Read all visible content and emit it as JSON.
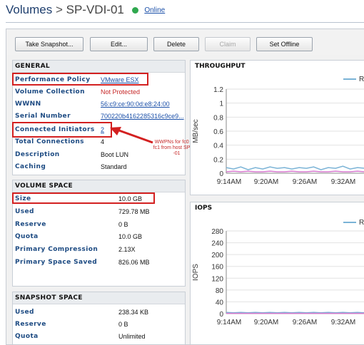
{
  "header": {
    "title": "Volumes",
    "separator": ">",
    "volume_name": "SP-VDI-01",
    "status": "Online",
    "status_color": "#2fa84f"
  },
  "toolbar": {
    "take_snapshot": "Take Snapshot...",
    "edit": "Edit...",
    "delete": "Delete",
    "claim": "Claim",
    "set_offline": "Set Offline"
  },
  "general": {
    "title": "GENERAL",
    "rows": [
      {
        "label": "Performance Policy",
        "value": "VMware ESX"
      },
      {
        "label": "Volume Collection",
        "value": "Not Protected"
      },
      {
        "label": "WWNN",
        "value": "56:c9:ce:90:0d:e8:24:00"
      },
      {
        "label": "Serial Number",
        "value": "700220b4162285316c9ce9..."
      },
      {
        "label": "Connected Initiators",
        "value": "2"
      },
      {
        "label": "Total Connections",
        "value": "4"
      },
      {
        "label": "Description",
        "value": "Boot LUN"
      },
      {
        "label": "Caching",
        "value": "Standard"
      }
    ]
  },
  "annotation": {
    "lines": [
      "WWPNs for fc0 and",
      "fc1 from host SP-VDI",
      "-01"
    ]
  },
  "volume_space": {
    "title": "VOLUME SPACE",
    "rows": [
      {
        "label": "Size",
        "value": "10.0 GB"
      },
      {
        "label": "Used",
        "value": "729.78 MB"
      },
      {
        "label": "Reserve",
        "value": "0 B"
      },
      {
        "label": "Quota",
        "value": "10.0 GB"
      },
      {
        "label": "Primary Compression",
        "value": "2.13X"
      },
      {
        "label": "Primary Space Saved",
        "value": "826.06 MB"
      }
    ]
  },
  "snapshot_space": {
    "title": "SNAPSHOT SPACE",
    "rows": [
      {
        "label": "Used",
        "value": "238.34 KB"
      },
      {
        "label": "Reserve",
        "value": "0 B"
      },
      {
        "label": "Quota",
        "value": "Unlimited"
      }
    ]
  },
  "colors": {
    "accent_red": "#d32020",
    "series_blue": "#7ab3d6",
    "series_pink": "#d87bd0"
  },
  "chart_data": [
    {
      "type": "line",
      "title": "THROUGHPUT",
      "ylabel": "MB/sec",
      "xlabel": "",
      "yticks": [
        "1.2",
        "1",
        "0.8",
        "0.6",
        "0.4",
        "0.2",
        "0"
      ],
      "ylim": [
        0,
        1.2
      ],
      "xticks": [
        "9:14AM",
        "9:20AM",
        "9:26AM",
        "9:32AM"
      ],
      "legend_placement": "top-right",
      "legend_label": "R",
      "grid": true,
      "series": [
        {
          "color": "#7ab3d6",
          "values": [
            0.08,
            0.06,
            0.09,
            0.05,
            0.08,
            0.06,
            0.09,
            0.07,
            0.08,
            0.06,
            0.08,
            0.07,
            0.09,
            0.05,
            0.08,
            0.07,
            0.1,
            0.06,
            0.08,
            0.07
          ]
        },
        {
          "color": "#d87bd0",
          "values": [
            0.02,
            0.03,
            0.02,
            0.03,
            0.02,
            0.02,
            0.03,
            0.02,
            0.02,
            0.03,
            0.02,
            0.02,
            0.03,
            0.02,
            0.02,
            0.03,
            0.02,
            0.02,
            0.03,
            0.02
          ]
        }
      ]
    },
    {
      "type": "line",
      "title": "IOPS",
      "ylabel": "IOPS",
      "xlabel": "",
      "yticks": [
        "280",
        "240",
        "200",
        "160",
        "120",
        "80",
        "40",
        "0"
      ],
      "ylim": [
        0,
        280
      ],
      "xticks": [
        "9:14AM",
        "9:20AM",
        "9:26AM",
        "9:32AM"
      ],
      "legend_placement": "top-right",
      "legend_label": "R",
      "grid": true,
      "series": [
        {
          "color": "#7ab3d6",
          "values": [
            4,
            3,
            4,
            3,
            4,
            3,
            4,
            3,
            4,
            3,
            4,
            3,
            4,
            3,
            4,
            3,
            4,
            3,
            4,
            3
          ]
        },
        {
          "color": "#d87bd0",
          "values": [
            1,
            1,
            1,
            1,
            1,
            1,
            1,
            1,
            1,
            1,
            1,
            1,
            1,
            1,
            1,
            1,
            1,
            1,
            1,
            1
          ]
        }
      ]
    }
  ]
}
